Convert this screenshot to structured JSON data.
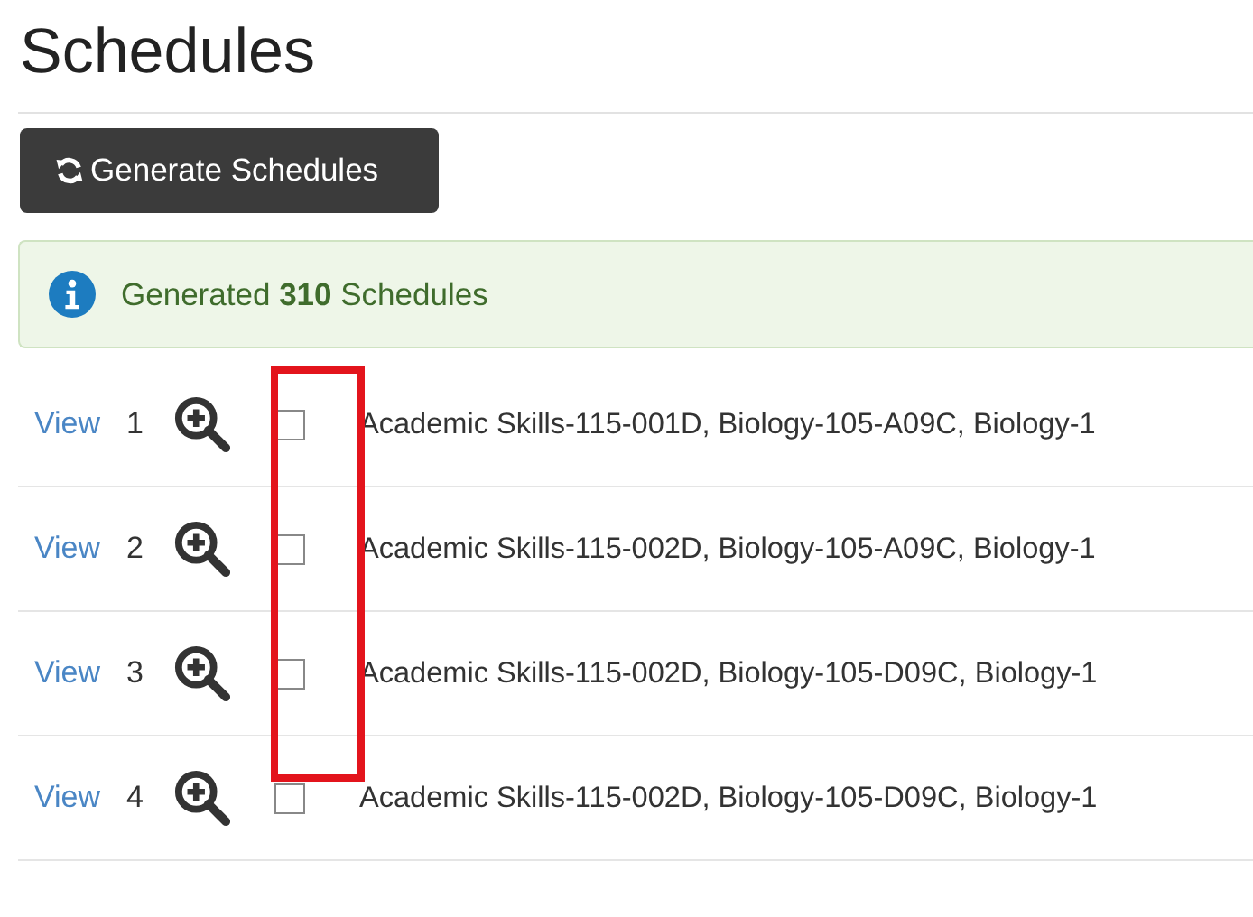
{
  "title": "Schedules",
  "generate_button": {
    "label": "Generate Schedules"
  },
  "alert": {
    "prefix": "Generated ",
    "count": "310",
    "suffix": " Schedules"
  },
  "rows": [
    {
      "link": "View",
      "number": "1",
      "checked": false,
      "courses": "Academic Skills-115-001D, Biology-105-A09C, Biology-1"
    },
    {
      "link": "View",
      "number": "2",
      "checked": false,
      "courses": "Academic Skills-115-002D, Biology-105-A09C, Biology-1"
    },
    {
      "link": "View",
      "number": "3",
      "checked": false,
      "courses": "Academic Skills-115-002D, Biology-105-D09C, Biology-1"
    },
    {
      "link": "View",
      "number": "4",
      "checked": false,
      "courses": "Academic Skills-115-002D, Biology-105-D09C, Biology-1"
    }
  ]
}
